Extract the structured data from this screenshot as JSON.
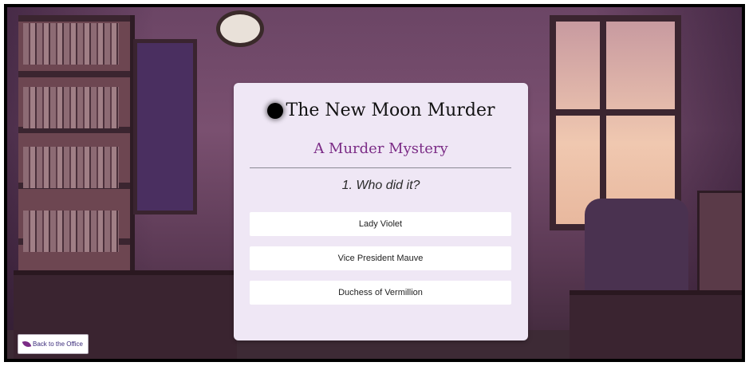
{
  "card": {
    "title": "The New Moon Murder",
    "subtitle": "A Murder Mystery",
    "question": "1. Who did it?",
    "options": [
      "Lady Violet",
      "Vice President Mauve",
      "Duchess of Vermillion"
    ]
  },
  "back_button": {
    "label": "Back to the Office",
    "icon": "leaf-icon"
  },
  "colors": {
    "card_bg": "#efe7f5",
    "accent": "#7b2c86",
    "option_bg": "#ffffff"
  }
}
